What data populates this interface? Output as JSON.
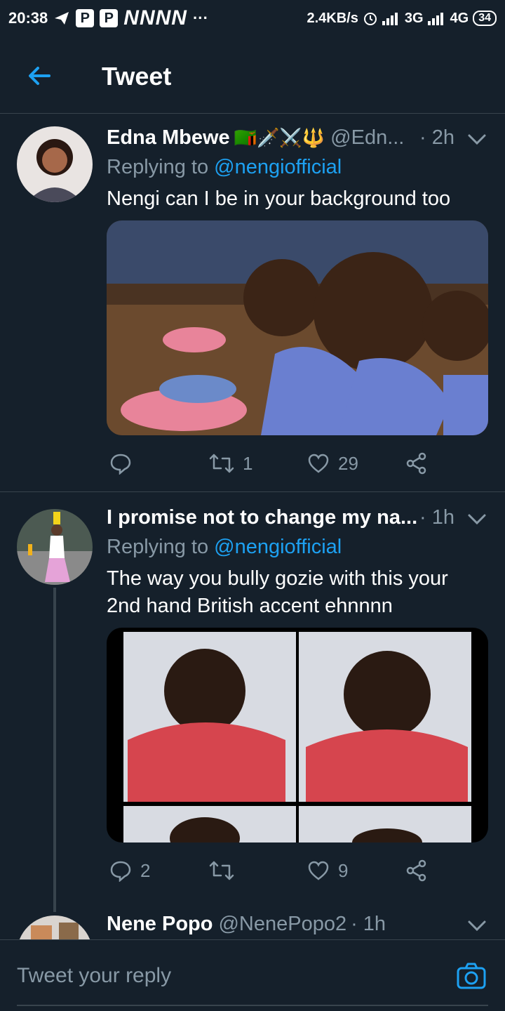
{
  "status_bar": {
    "time": "20:38",
    "p_badge_1": "P",
    "p_badge_2": "P",
    "n_letters": "NNNN",
    "dots": "···",
    "speed": "2.4KB/s",
    "net1": "3G",
    "net2": "4G",
    "battery": "34"
  },
  "header": {
    "title": "Tweet",
    "back_icon": "arrow-left-icon"
  },
  "tweets": [
    {
      "name": "Edna Mbewe",
      "emojis": "🇿🇲🗡️⚔️🔱",
      "handle": "@Edn...",
      "time": "· 2h",
      "replying_prefix": "Replying to",
      "replying_to": "@nengiofficial",
      "text": "Nengi can I be in your background too",
      "actions": {
        "reply": "",
        "retweet": "1",
        "like": "29"
      }
    },
    {
      "name": "I promise not to change my na...",
      "handle": "",
      "time": "· 1h",
      "replying_prefix": "Replying to",
      "replying_to": "@nengiofficial",
      "text": "The way you bully gozie with this your 2nd hand British accent ehnnnn",
      "actions": {
        "reply": "2",
        "retweet": "",
        "like": "9"
      }
    },
    {
      "name": "Nene Popo",
      "handle": "@NenePopo2",
      "time": "· 1h"
    }
  ],
  "reply_bar": {
    "placeholder": "Tweet your reply",
    "camera_icon": "camera-icon"
  },
  "colors": {
    "background": "#15202b",
    "accent": "#1da1f2",
    "muted": "#8899a6",
    "divider": "#38444d"
  }
}
